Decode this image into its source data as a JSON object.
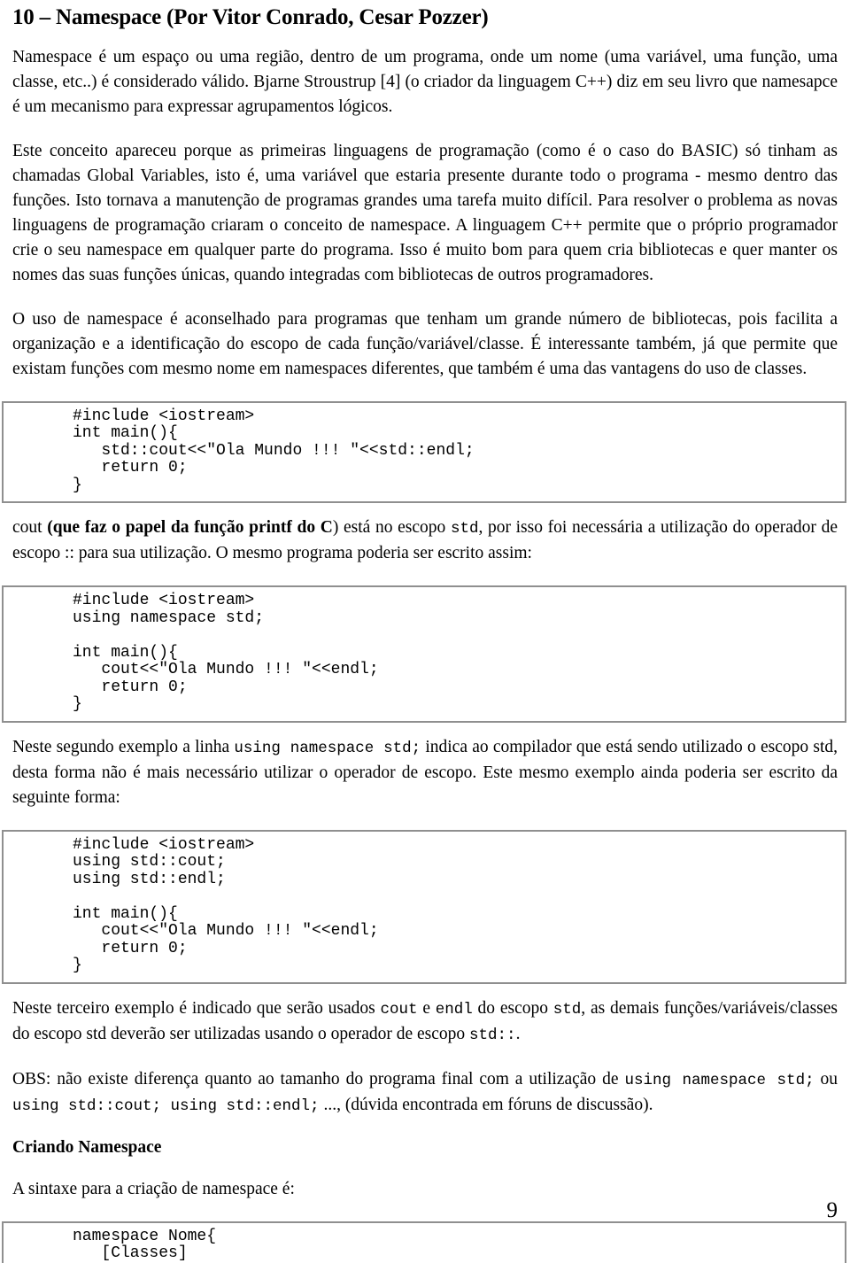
{
  "document": {
    "title": "10 – Namespace (Por Vitor Conrado, Cesar Pozzer)",
    "page_number": "9"
  },
  "paragraphs": {
    "intro": "Namespace é um espaço ou uma região, dentro de um programa, onde um nome (uma variável, uma função, uma classe, etc..) é considerado válido. Bjarne Stroustrup [4] (o criador da linguagem C++) diz em seu livro que namesapce é um mecanismo para expressar agrupamentos lógicos.",
    "history": "Este conceito apareceu porque as primeiras linguagens de programação (como é o caso do BASIC) só tinham as chamadas Global Variables, isto é, uma variável que estaria presente durante todo o programa - mesmo dentro das funções. Isto tornava a manutenção de programas grandes uma tarefa muito difícil. Para resolver o problema as novas linguagens de programação criaram o conceito de namespace. A linguagem C++ permite que o próprio programador crie o seu namespace em qualquer parte do programa. Isso é muito bom para quem cria bibliotecas e quer manter os nomes das suas funções únicas, quando integradas com bibliotecas de outros programadores.",
    "advice": "O uso de namespace é aconselhado para programas que tenham um grande número de bibliotecas, pois facilita a organização e a identificação do escopo de cada função/variável/classe. É interessante também, já que permite que existam funções com mesmo nome em namespaces diferentes, que também é uma das vantagens do uso de classes.",
    "after_code1": {
      "part1": "cout ",
      "bold": "(que faz o papel da função printf do C",
      "part2": ") está no escopo ",
      "code1": "std",
      "part3": ", por isso foi necessária a utilização do operador de escopo :: para sua utilização. O mesmo programa poderia ser escrito assim:"
    },
    "after_code2": {
      "part1": "Neste segundo exemplo a linha ",
      "code1": "using namespace std;",
      "part2": " indica ao compilador que está sendo utilizado o escopo std, desta forma não é mais necessário utilizar o operador de escopo. Este mesmo exemplo ainda poderia ser escrito da seguinte forma:"
    },
    "after_code3": {
      "part1": "Neste terceiro exemplo é indicado que serão usados ",
      "code1": "cout",
      "part2": " e ",
      "code2": "endl",
      "part3": " do escopo ",
      "code3": "std",
      "part4": ", as demais funções/variáveis/classes do escopo std deverão ser utilizadas usando o operador de escopo ",
      "code4": "std::",
      "part5": "."
    },
    "obs": {
      "part1": "OBS: não existe diferença quanto ao tamanho do programa final com a utilização de ",
      "code1": "using namespace std;",
      "part2": " ou ",
      "code2": "using std::cout; using std::endl;",
      "part3": " ..., (dúvida encontrada em fóruns de discussão)."
    },
    "syntax_intro": "A sintaxe para a criação de namespace é:"
  },
  "section_heading": "Criando Namespace",
  "code_blocks": {
    "block1": "#include <iostream>\nint main(){\n   std::cout<<\"Ola Mundo !!! \"<<std::endl;\n   return 0;\n}",
    "block2": "#include <iostream>\nusing namespace std;\n\nint main(){\n   cout<<\"Ola Mundo !!! \"<<endl;\n   return 0;\n}",
    "block3": "#include <iostream>\nusing std::cout;\nusing std::endl;\n\nint main(){\n   cout<<\"Ola Mundo !!! \"<<endl;\n   return 0;\n}",
    "block4": "namespace Nome{\n   [Classes]"
  }
}
